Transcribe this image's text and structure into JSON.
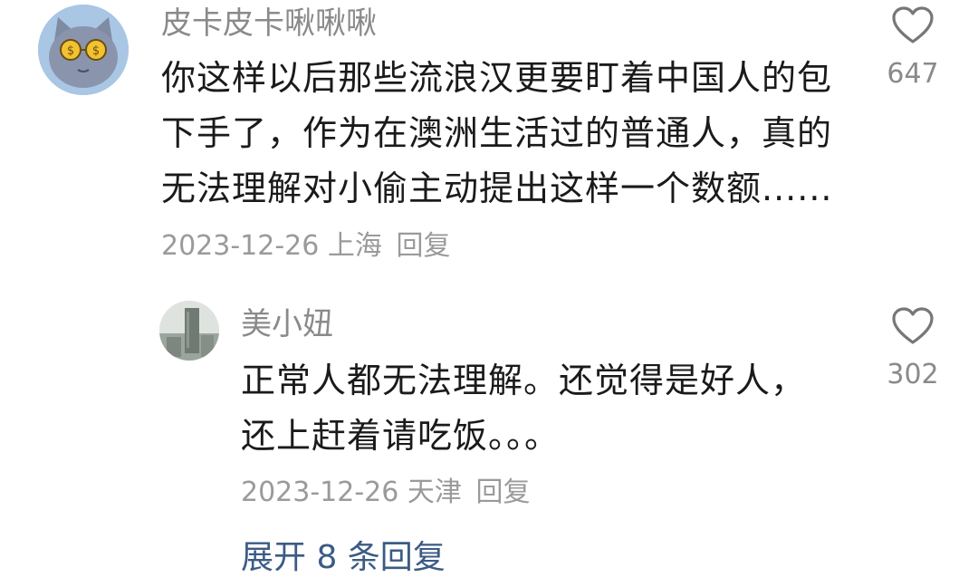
{
  "comments": [
    {
      "username": "皮卡皮卡啾啾啾",
      "lines": [
        "你这样以后那些流浪汉更要盯着中国人的包",
        "下手了，作为在澳洲生活过的普通人，真的",
        "无法理解对小偷主动提出这样一个数额......"
      ],
      "date": "2023-12-26",
      "location": "上海",
      "reply_label": "回复",
      "like_count": "647",
      "avatar_icon": "cat-with-money-glasses-avatar"
    },
    {
      "username": "美小妞",
      "lines": [
        "正常人都无法理解。还觉得是好人，",
        "还上赶着请吃饭。。。"
      ],
      "date": "2023-12-26",
      "location": "天津",
      "reply_label": "回复",
      "like_count": "302",
      "avatar_icon": "building-photo-avatar"
    }
  ],
  "expand_replies": "展开 8 条回复",
  "colors": {
    "username": "#8a8a8a",
    "content": "#1a1a1a",
    "meta": "#9a9a9a",
    "link": "#3b5b85",
    "heart_outline": "#777777"
  }
}
